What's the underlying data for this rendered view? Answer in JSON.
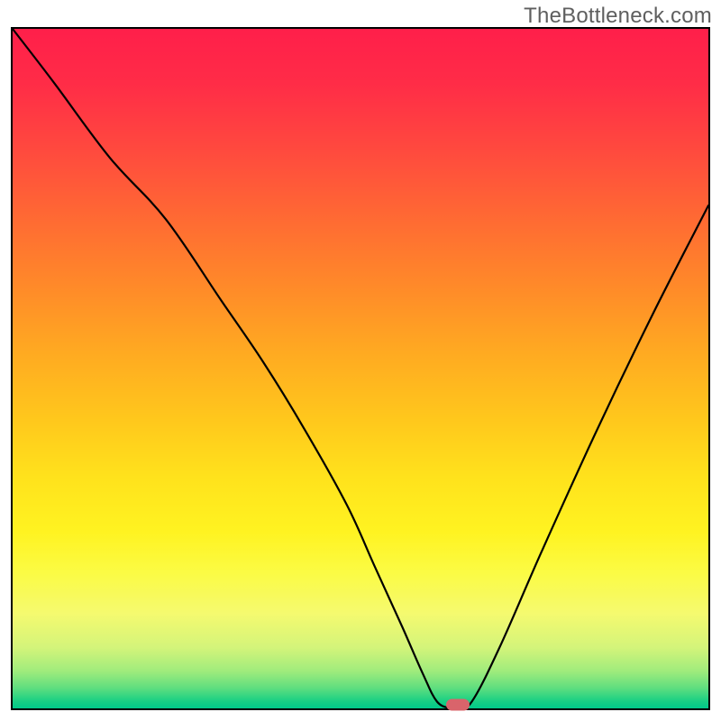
{
  "watermark": {
    "text": "TheBottleneck.com"
  },
  "chart_data": {
    "type": "line",
    "title": "",
    "xlabel": "",
    "ylabel": "",
    "xlim": [
      0,
      100
    ],
    "ylim": [
      0,
      100
    ],
    "grid": false,
    "background": {
      "type": "vertical-gradient",
      "meaning": "red=high bottleneck at top through yellow to green=low bottleneck at bottom",
      "stops": [
        {
          "pos": 0,
          "color": "#ff1f4a"
        },
        {
          "pos": 50,
          "color": "#ffc31c"
        },
        {
          "pos": 80,
          "color": "#fbfb44"
        },
        {
          "pos": 100,
          "color": "#00c98a"
        }
      ]
    },
    "series": [
      {
        "name": "bottleneck-curve",
        "comment": "V-shaped curve. y ≈ bottleneck %. x ≈ relative component class. Minimum (~0%) near x≈64.",
        "x": [
          0,
          6,
          14,
          22,
          30,
          36,
          42,
          48,
          52,
          56,
          59,
          61,
          63,
          64,
          66,
          70,
          76,
          84,
          92,
          100
        ],
        "values": [
          100,
          92,
          81,
          72,
          60,
          51,
          41,
          30,
          21,
          12,
          5,
          1,
          0,
          0,
          1,
          9,
          23,
          41,
          58,
          74
        ]
      }
    ],
    "annotations": [
      {
        "name": "optimal-marker",
        "shape": "pill",
        "color": "#d9646b",
        "x": 64,
        "y": 0
      }
    ]
  }
}
